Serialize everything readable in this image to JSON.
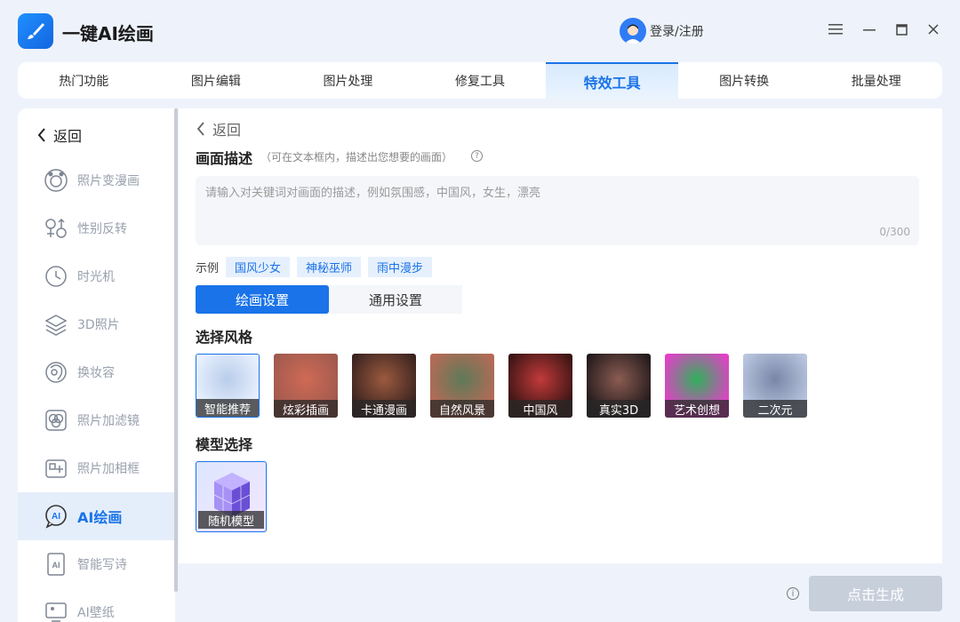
{
  "app": {
    "title": "一键AI绘画",
    "login_label": "登录/注册"
  },
  "top_tabs": [
    {
      "label": "热门功能",
      "active": false
    },
    {
      "label": "图片编辑",
      "active": false
    },
    {
      "label": "图片处理",
      "active": false
    },
    {
      "label": "修复工具",
      "active": false
    },
    {
      "label": "特效工具",
      "active": true
    },
    {
      "label": "图片转换",
      "active": false
    },
    {
      "label": "批量处理",
      "active": false
    }
  ],
  "sidebar": {
    "back_label": "返回",
    "items": [
      {
        "label": "照片变漫画",
        "icon": "bear-face-icon"
      },
      {
        "label": "性别反转",
        "icon": "gender-icon"
      },
      {
        "label": "时光机",
        "icon": "clock-icon"
      },
      {
        "label": "3D照片",
        "icon": "layers-icon"
      },
      {
        "label": "换妆容",
        "icon": "makeup-face-icon"
      },
      {
        "label": "照片加滤镜",
        "icon": "filter-icon"
      },
      {
        "label": "照片加相框",
        "icon": "frame-icon"
      },
      {
        "label": "AI绘画",
        "icon": "ai-chat-icon",
        "active": true
      },
      {
        "label": "智能写诗",
        "icon": "ai-doc-icon"
      },
      {
        "label": "AI壁纸",
        "icon": "wallpaper-icon"
      }
    ]
  },
  "main": {
    "back_label": "返回",
    "desc_title": "画面描述",
    "desc_hint": "（可在文本框内，描述出您想要的画面）",
    "desc_placeholder": "请输入对关键词对画面的描述，例如氛围感，中国风，女生，漂亮",
    "counter": "0/300",
    "examples_label": "示例",
    "examples": [
      "国风少女",
      "神秘巫师",
      "雨中漫步"
    ],
    "settings_tabs": [
      {
        "label": "绘画设置",
        "active": true
      },
      {
        "label": "通用设置",
        "active": false
      }
    ],
    "style_title": "选择风格",
    "styles": [
      {
        "label": "智能推荐",
        "selected": true,
        "colors": [
          "#eaf2ff",
          "#b9cdea"
        ]
      },
      {
        "label": "炫彩插画",
        "selected": false,
        "colors": [
          "#a05a4e",
          "#cf6a55"
        ]
      },
      {
        "label": "卡通漫画",
        "selected": false,
        "colors": [
          "#3a2320",
          "#9b5a3e"
        ]
      },
      {
        "label": "自然风景",
        "selected": false,
        "colors": [
          "#b86a56",
          "#5e7a58"
        ]
      },
      {
        "label": "中国风",
        "selected": false,
        "colors": [
          "#3a1414",
          "#c23a3a"
        ]
      },
      {
        "label": "真实3D",
        "selected": false,
        "colors": [
          "#231a1c",
          "#8b5c52"
        ]
      },
      {
        "label": "艺术创想",
        "selected": false,
        "colors": [
          "#e63ec9",
          "#2fb05a"
        ]
      },
      {
        "label": "二次元",
        "selected": false,
        "colors": [
          "#b9c6de",
          "#7a86a8"
        ]
      }
    ],
    "model_title": "模型选择",
    "model_label": "随机模型"
  },
  "footer": {
    "generate_label": "点击生成"
  }
}
